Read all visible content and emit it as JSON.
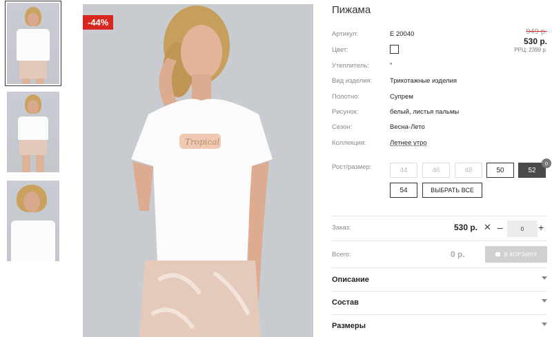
{
  "product": {
    "title": "Пижама",
    "discount_badge": "-44%",
    "price_old": "949 р.",
    "price_new": "530 р.",
    "price_rrc": "РРЦ: 2399 р."
  },
  "specs": [
    {
      "key": "Артикул:",
      "value": "Е 20040"
    },
    {
      "key": "Цвет:",
      "value": ""
    },
    {
      "key": "Утеплитель:",
      "value": "\""
    },
    {
      "key": "Вид изделия:",
      "value": "Трикотажные изделия"
    },
    {
      "key": "Полотно:",
      "value": "Супрем"
    },
    {
      "key": "Рисунок:",
      "value": "белый, листья пальмы"
    },
    {
      "key": "Сезон:",
      "value": "Весна-Лето"
    },
    {
      "key": "Коллекция:",
      "value": "Летнее утро"
    }
  ],
  "sizes": {
    "label": "Рост/размер:",
    "options": [
      "44",
      "46",
      "48",
      "50",
      "52",
      "54"
    ],
    "selected": "52",
    "selected_count": "0",
    "select_all_label": "ВЫБРАТЬ ВСЕ"
  },
  "order": {
    "label": "Заказ:",
    "price": "530 р.",
    "times": "✕",
    "minus": "–",
    "plus": "+",
    "quantity": "0",
    "total_label": "Всего:",
    "total_price": "0 р.",
    "cart_button": "В КОРЗИНУ"
  },
  "accordion": [
    "Описание",
    "Состав",
    "Размеры"
  ],
  "colors": {
    "badge": "#d7261f",
    "selected_size": "#4a4a4a",
    "cart_disabled": "#d0d0d0"
  }
}
